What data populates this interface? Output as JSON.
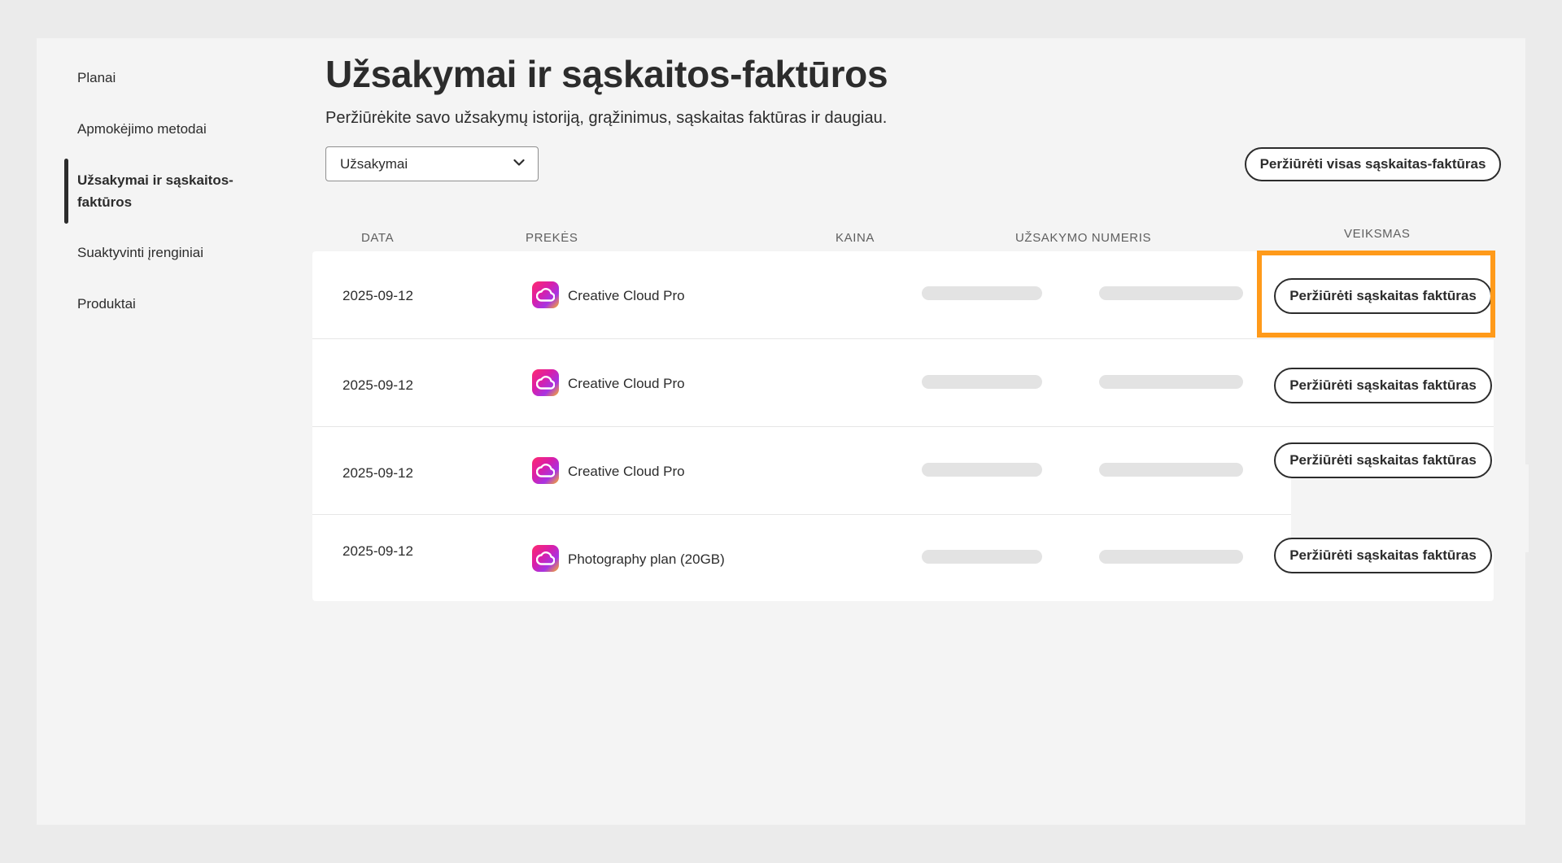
{
  "sidebar": {
    "items": [
      {
        "label": "Planai",
        "active": false
      },
      {
        "label": "Apmokėjimo metodai",
        "active": false
      },
      {
        "label": "Užsakymai ir sąskaitos-faktūros",
        "active": true
      },
      {
        "label": "Suaktyvinti įrenginiai",
        "active": false
      },
      {
        "label": "Produktai",
        "active": false
      }
    ]
  },
  "main": {
    "title": "Užsakymai ir sąskaitos-faktūros",
    "subtitle": "Peržiūrėkite savo užsakymų istoriją, grąžinimus, sąskaitas faktūras ir daugiau.",
    "filter": {
      "selected": "Užsakymai",
      "icon": "chevron-down-icon"
    },
    "view_all_label": "Peržiūrėti visas sąskaitas-faktūras"
  },
  "table": {
    "headers": {
      "date": "DATA",
      "items": "PREKĖS",
      "price": "KAINA",
      "order_number": "UŽSAKYMO NUMERIS",
      "action": "VEIKSMAS"
    },
    "rows": [
      {
        "date": "2025-09-12",
        "product": "Creative Cloud Pro",
        "action_label": "Peržiūrėti sąskaitas faktūras"
      },
      {
        "date": "2025-09-12",
        "product": "Creative Cloud Pro",
        "action_label": "Peržiūrėti sąskaitas faktūras"
      },
      {
        "date": "2025-09-12",
        "product": "Creative Cloud Pro",
        "action_label": "Peržiūrėti sąskaitas faktūras"
      },
      {
        "date": "2025-09-12",
        "product": "Photography plan (20GB)",
        "action_label": "Peržiūrėti sąskaitas faktūras"
      }
    ]
  },
  "colors": {
    "highlight": "#ff9a1a",
    "text": "#2c2c2c",
    "redacted": "#e3e3e3"
  }
}
